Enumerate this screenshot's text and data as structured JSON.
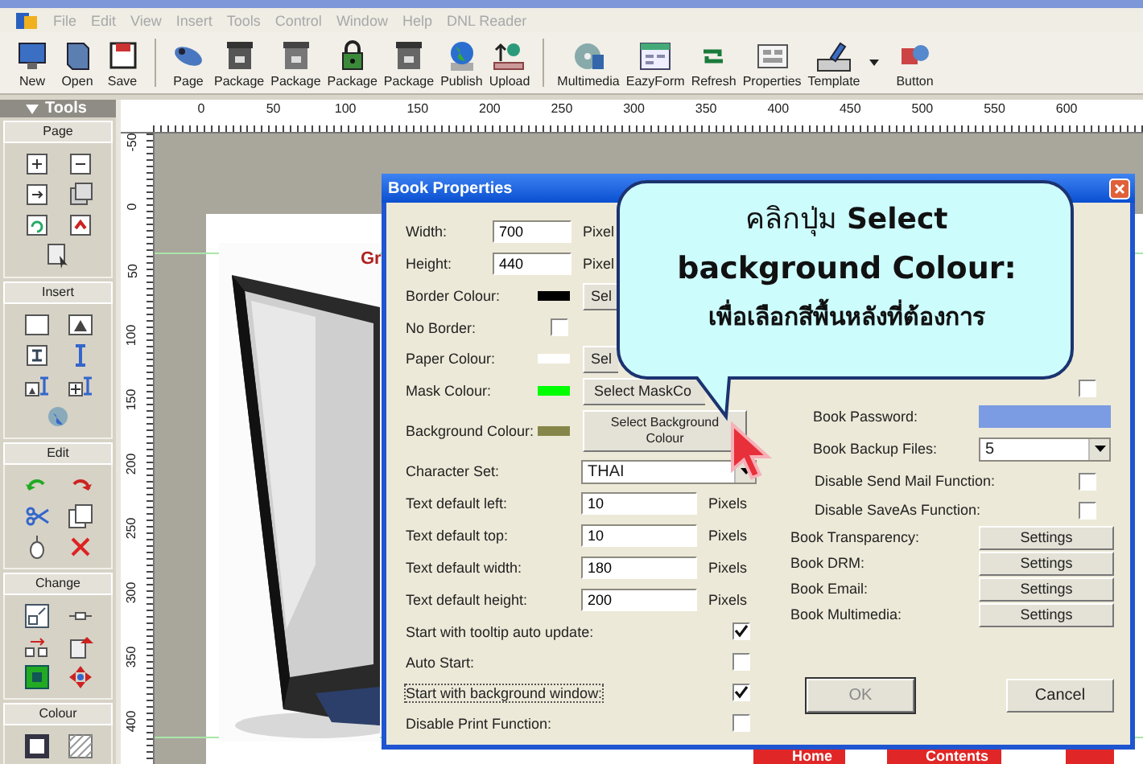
{
  "menu": [
    "File",
    "Edit",
    "View",
    "Insert",
    "Tools",
    "Control",
    "Window",
    "Help",
    "DNL Reader"
  ],
  "toolbar": [
    [
      {
        "label": "New"
      },
      {
        "label": "Open"
      },
      {
        "label": "Save"
      }
    ],
    [
      {
        "label": "Page"
      },
      {
        "label": "Package"
      },
      {
        "label": "Package"
      },
      {
        "label": "Package"
      },
      {
        "label": "Package"
      },
      {
        "label": "Publish"
      },
      {
        "label": "Upload"
      }
    ],
    [
      {
        "label": "Multimedia"
      },
      {
        "label": "EazyForm"
      },
      {
        "label": "Refresh"
      },
      {
        "label": "Properties"
      },
      {
        "label": "Template",
        "dropdown": true
      },
      {
        "label": "Button"
      }
    ]
  ],
  "tools_panel": {
    "title": "Tools",
    "sections": [
      {
        "title": "Page"
      },
      {
        "title": "Insert"
      },
      {
        "title": "Edit"
      },
      {
        "title": "Change"
      },
      {
        "title": "Colour"
      }
    ]
  },
  "ruler": {
    "horizontal": [
      "0",
      "50",
      "100",
      "150",
      "200",
      "250",
      "300",
      "350",
      "400",
      "450",
      "500",
      "550",
      "600"
    ],
    "vertical": [
      "-50",
      "0",
      "50",
      "100",
      "150",
      "200",
      "250",
      "300",
      "350",
      "400"
    ]
  },
  "page": {
    "heading": "Gr",
    "nav_buttons": [
      "Home",
      "Contents"
    ]
  },
  "dialog": {
    "title": "Book Properties",
    "left": [
      {
        "kind": "size",
        "label": "Width:",
        "value": "700",
        "unit": "Pixel"
      },
      {
        "kind": "size",
        "label": "Height:",
        "value": "440",
        "unit": "Pixel"
      },
      {
        "kind": "colour",
        "label": "Border Colour:",
        "color": "#000000",
        "button": "Sel"
      },
      {
        "kind": "checkbox",
        "label": "No Border:",
        "checked": false
      },
      {
        "kind": "colour",
        "label": "Paper Colour:",
        "color": "#ffffff",
        "button": "Sel"
      },
      {
        "kind": "colour",
        "label": "Mask Colour:",
        "color": "#00ff00",
        "button": "Select MaskCo"
      },
      {
        "kind": "colour",
        "label": "Background Colour:",
        "color": "#86864a",
        "button": "Select Background Colour"
      },
      {
        "kind": "select",
        "label": "Character Set:",
        "value": "THAI"
      },
      {
        "kind": "field",
        "label": "Text default left:",
        "value": "10",
        "unit": "Pixels"
      },
      {
        "kind": "field",
        "label": "Text default top:",
        "value": "10",
        "unit": "Pixels"
      },
      {
        "kind": "field",
        "label": "Text default width:",
        "value": "180",
        "unit": "Pixels"
      },
      {
        "kind": "field",
        "label": "Text default height:",
        "value": "200",
        "unit": "Pixels"
      },
      {
        "kind": "checkbox",
        "label": "Start with tooltip auto update:",
        "checked": true
      },
      {
        "kind": "checkbox",
        "label": "Auto Start:",
        "checked": false
      },
      {
        "kind": "checkbox",
        "label": "Start with background window:",
        "checked": true,
        "focused": true
      },
      {
        "kind": "checkbox",
        "label": "Disable Print Function:",
        "checked": false
      }
    ],
    "right": [
      {
        "kind": "checkbox",
        "checked": false
      },
      {
        "kind": "password",
        "label": "Book Password:"
      },
      {
        "kind": "select",
        "label": "Book Backup Files:",
        "value": "5"
      },
      {
        "kind": "checkbox",
        "label": "Disable Send Mail Function:",
        "checked": false
      },
      {
        "kind": "checkbox",
        "label": "Disable SaveAs Function:",
        "checked": false
      },
      {
        "kind": "button",
        "label": "Book Transparency:",
        "button": "Settings"
      },
      {
        "kind": "button",
        "label": "Book DRM:",
        "button": "Settings"
      },
      {
        "kind": "button",
        "label": "Book Email:",
        "button": "Settings"
      },
      {
        "kind": "button",
        "label": "Book Multimedia:",
        "button": "Settings"
      }
    ],
    "buttons": [
      "OK",
      "Cancel"
    ]
  },
  "callout": {
    "lines": [
      {
        "kind": "mixed",
        "text": "คลิกปุ่ม **Select**"
      },
      {
        "kind": "bold",
        "text": "background Colour:"
      },
      {
        "kind": "small",
        "text": "เพื่อเลือกสีพื้นหลังที่ต้องการ"
      }
    ]
  }
}
